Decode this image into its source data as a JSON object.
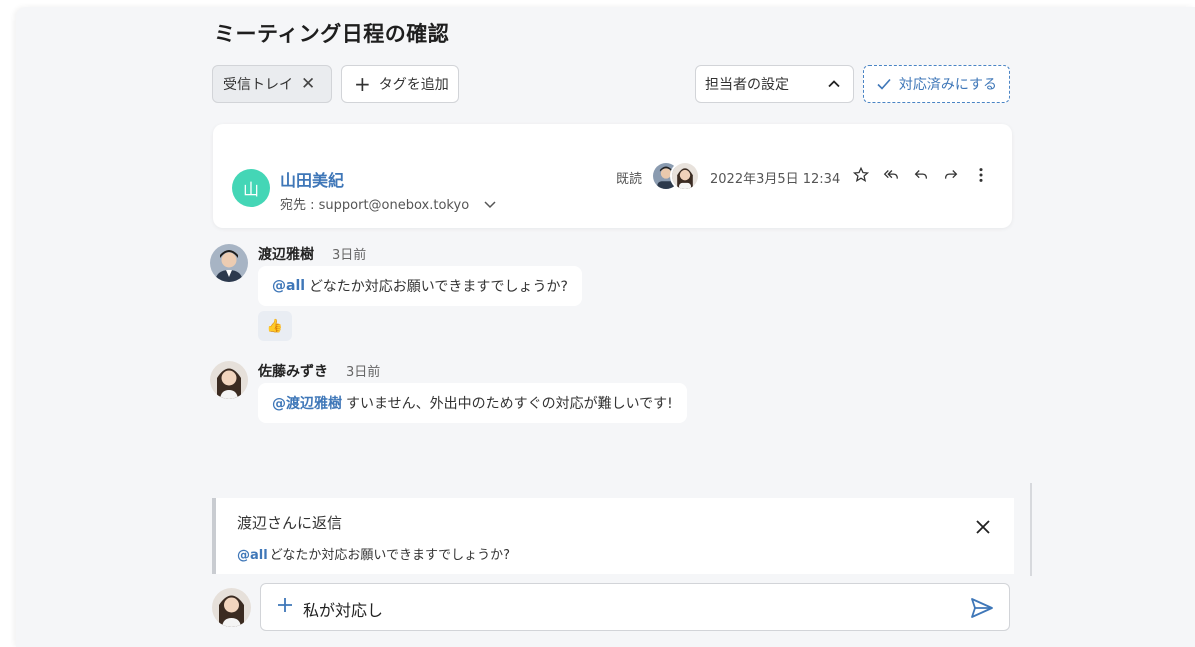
{
  "title": "ミーティング日程の確認",
  "tags": {
    "inbox_label": "受信トレイ",
    "add_label": "タグを追加"
  },
  "assignee": {
    "label": "担当者の設定"
  },
  "done_button": {
    "label": "対応済みにする"
  },
  "mail": {
    "sender_initial": "山",
    "sender_name": "山田美紀",
    "recipient": "宛先 : support@onebox.tokyo",
    "read_label": "既読",
    "date": "2022年3月5日 12:34"
  },
  "comments": [
    {
      "name": "渡辺雅樹",
      "time": "3日前",
      "mention": "@all",
      "text": "どなたか対応お願いできますでしょうか?",
      "reaction": "👍"
    },
    {
      "name": "佐藤みずき",
      "time": "3日前",
      "mention": "@渡辺雅樹",
      "text": "すいません、外出中のためすぐの対応が難しいです!"
    }
  ],
  "reply": {
    "title": "渡辺さんに返信",
    "mention": "@all",
    "quote": "どなたか対応お願いできますでしょうか?"
  },
  "composer": {
    "text": "私が対応し"
  },
  "colors": {
    "accent": "#3f77b8",
    "sender_avatar": "#44d6b6",
    "panel_bg": "#f5f6f8"
  }
}
